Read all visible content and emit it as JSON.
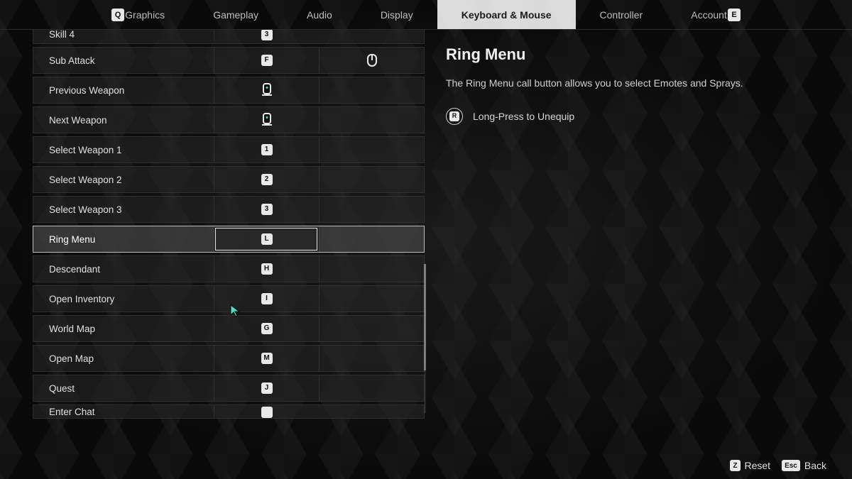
{
  "nav": {
    "prev_key": "Q",
    "next_key": "E",
    "tabs": [
      {
        "label": "Graphics",
        "active": false
      },
      {
        "label": "Gameplay",
        "active": false
      },
      {
        "label": "Audio",
        "active": false
      },
      {
        "label": "Display",
        "active": false
      },
      {
        "label": "Keyboard & Mouse",
        "active": true
      },
      {
        "label": "Controller",
        "active": false
      },
      {
        "label": "Account",
        "active": false
      }
    ]
  },
  "bindings": [
    {
      "label": "Skill 4",
      "primary_type": "key",
      "primary": "3",
      "secondary_type": "none",
      "secondary": "",
      "cut": "top"
    },
    {
      "label": "Sub Attack",
      "primary_type": "key",
      "primary": "F",
      "secondary_type": "mouse",
      "secondary": "side"
    },
    {
      "label": "Previous Weapon",
      "primary_type": "wheel",
      "primary": "up",
      "secondary_type": "none",
      "secondary": ""
    },
    {
      "label": "Next Weapon",
      "primary_type": "wheel",
      "primary": "dn",
      "secondary_type": "none",
      "secondary": ""
    },
    {
      "label": "Select Weapon 1",
      "primary_type": "key",
      "primary": "1",
      "secondary_type": "none",
      "secondary": ""
    },
    {
      "label": "Select Weapon 2",
      "primary_type": "key",
      "primary": "2",
      "secondary_type": "none",
      "secondary": ""
    },
    {
      "label": "Select Weapon 3",
      "primary_type": "key",
      "primary": "3",
      "secondary_type": "none",
      "secondary": ""
    },
    {
      "label": "Ring Menu",
      "primary_type": "key",
      "primary": "L",
      "secondary_type": "none",
      "secondary": "",
      "selected": true
    },
    {
      "label": "Descendant",
      "primary_type": "key",
      "primary": "H",
      "secondary_type": "none",
      "secondary": ""
    },
    {
      "label": "Open Inventory",
      "primary_type": "key",
      "primary": "I",
      "secondary_type": "none",
      "secondary": ""
    },
    {
      "label": "World Map",
      "primary_type": "key",
      "primary": "G",
      "secondary_type": "none",
      "secondary": ""
    },
    {
      "label": "Open Map",
      "primary_type": "key",
      "primary": "M",
      "secondary_type": "none",
      "secondary": ""
    },
    {
      "label": "Quest",
      "primary_type": "key",
      "primary": "J",
      "secondary_type": "none",
      "secondary": ""
    },
    {
      "label": "Enter Chat",
      "primary_type": "key",
      "primary": "",
      "secondary_type": "none",
      "secondary": "",
      "cut": "bottom"
    }
  ],
  "detail": {
    "title": "Ring Menu",
    "description": "The Ring Menu call button allows you to select Emotes and Sprays.",
    "hint_key": "R",
    "hint_text": "Long-Press to Unequip"
  },
  "footer": {
    "reset_key": "Z",
    "reset_label": "Reset",
    "back_key": "Esc",
    "back_label": "Back"
  }
}
